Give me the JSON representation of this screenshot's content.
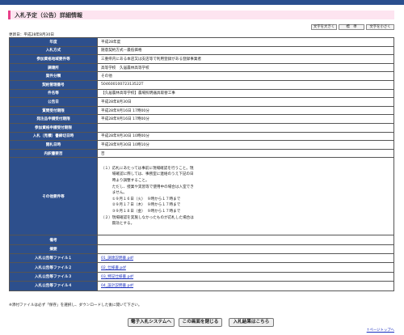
{
  "title": "入札予定（公告）詳細情報",
  "font_controls": {
    "large": "文字を大きく",
    "standard": "標　準",
    "small": "文字を小さく"
  },
  "updated": "更新日：平成28年8月30日",
  "rows": [
    {
      "label": "年度",
      "value": "平成28年度"
    },
    {
      "label": "入札方式",
      "value": "随意契約方式－最低価格"
    },
    {
      "label": "参加資格地域要件等",
      "value": "三重県内にある本店又は支店等で利用登録がある登録事業者"
    },
    {
      "label": "調達所",
      "value": "高等学校　久居農林高等学校"
    },
    {
      "label": "案件分類",
      "value": "その他"
    },
    {
      "label": "契約管理番号",
      "value": "50460010072313522T"
    },
    {
      "label": "件名等",
      "value": "【久居農林高等学校】農場照明器具取替工事"
    },
    {
      "label": "公告日",
      "value": "平成28年8月30日"
    },
    {
      "label": "質問受付期限",
      "value": "平成28年9月16日 17時00分"
    },
    {
      "label": "発注品申請受付期限",
      "value": "平成28年9月16日 17時00分"
    },
    {
      "label": "参加資格申請受付期限",
      "value": ""
    },
    {
      "label": "入札（見積）書締切日時",
      "value": "平成28年9月30日 10時00分"
    },
    {
      "label": "開札日時",
      "value": "平成28年9月30日 10時10分"
    },
    {
      "label": "内訳書要否",
      "value": "否"
    }
  ],
  "notes": {
    "label": "その他要件等",
    "lines": [
      "（１）応札にあたっては事前に現場確認を行うこと。現",
      "　　　場確認に際しては、事務室に連絡のうえ下記の日",
      "　　　時より調整すること。",
      "　　　ただし、授業や実習等で使用中の場合は入室でき",
      "　　　ません。",
      "　　　①９月１６日（火）　９時から１７時まで",
      "　　　②９月１７日（木）　９時から１７時まで",
      "　　　③９月１８日（金）　９時から１７時まで",
      "（２）現場確認を実施しなかったものが応札した場合は",
      "　　　無効とする。"
    ]
  },
  "rows_after": [
    {
      "label": "備考",
      "value": ""
    },
    {
      "label": "摘要",
      "value": ""
    }
  ],
  "attachments": [
    {
      "label": "入札公告等ファイル１",
      "link": "01_調達説明書.pdf"
    },
    {
      "label": "入札公告等ファイル２",
      "link": "02_仕様書.pdf"
    },
    {
      "label": "入札公告等ファイル３",
      "link": "03_特記仕様書.pdf"
    },
    {
      "label": "入札公告等ファイル４",
      "link": "04_設計説明書.pdf"
    }
  ],
  "footnote": "※添付ファイルは必ず「保存」を選択し、ダウンロードした後に開いて下さい。",
  "buttons": {
    "system": "電子入札システムへ",
    "close": "この画面を閉じる",
    "results": "入札結果はこちら"
  },
  "page_top": "↑ページトップへ"
}
